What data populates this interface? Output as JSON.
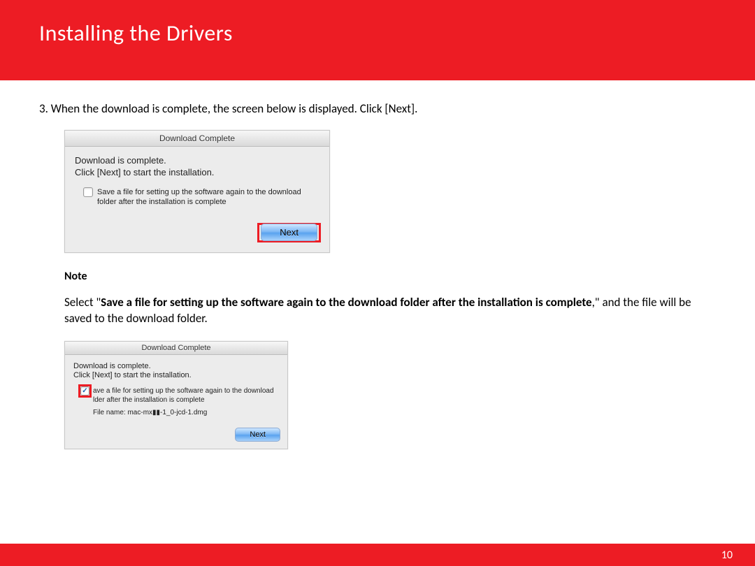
{
  "header": {
    "title": "Installing  the Drivers"
  },
  "step": {
    "text": "3. When the download is complete, the screen below is displayed. Click [Next]."
  },
  "dialog1": {
    "title": "Download Complete",
    "line1": "Download is complete.",
    "line2": "Click [Next] to start the installation.",
    "checkbox_label": "Save a file for setting up the software again to the download folder after the installation is complete",
    "next": "Next"
  },
  "note": {
    "heading": "Note",
    "pre": "Select \"",
    "bold": "Save a file for setting up the software again to the download folder after the installation is complete",
    "post": ",\" and the file will be saved to the download folder."
  },
  "dialog2": {
    "title": "Download Complete",
    "line1": "Download is complete.",
    "line2": "Click [Next] to start the installation.",
    "checkbox_label_a": "ave a file for setting up the software again to the download",
    "checkbox_label_b": "lder after the installation is complete",
    "file_label": "File name:",
    "file_name": "mac-mx▮▮-1_0-jcd-1.dmg",
    "next": "Next"
  },
  "page_number": "10"
}
